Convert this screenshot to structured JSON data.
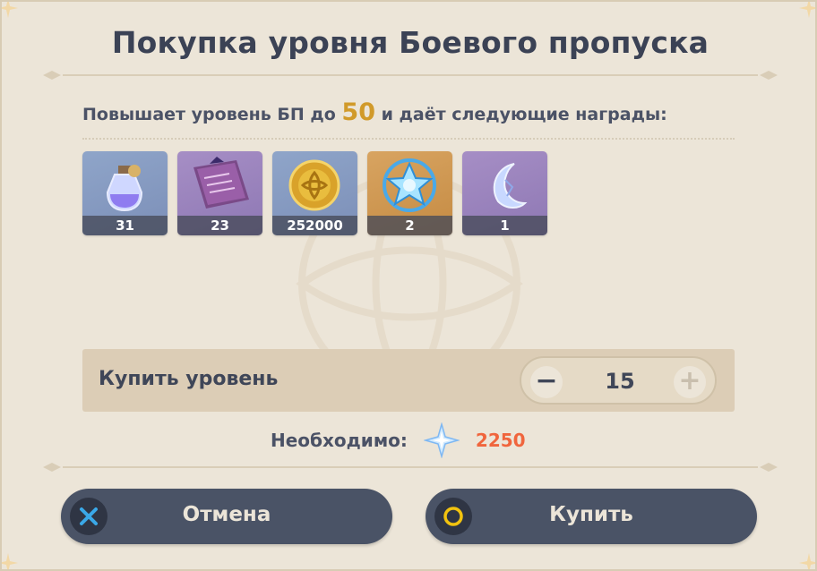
{
  "dialog": {
    "title": "Покупка уровня Боевого пропуска",
    "subtitle_pre": "Повышает уровень БП до",
    "target_level": "50",
    "subtitle_post": "и даёт следующие награды:"
  },
  "rewards": [
    {
      "name": "potion-icon",
      "count": "31"
    },
    {
      "name": "book-icon",
      "count": "23"
    },
    {
      "name": "mora-coin-icon",
      "count": "252000"
    },
    {
      "name": "crystal-icon",
      "count": "2"
    },
    {
      "name": "moon-crystal-icon",
      "count": "1"
    }
  ],
  "purchase": {
    "label": "Купить уровень",
    "quantity": "15",
    "minus": "−",
    "plus": "+"
  },
  "cost": {
    "label": "Необходимо:",
    "currency_icon": "primogem-icon",
    "amount": "2250"
  },
  "buttons": {
    "cancel": "Отмена",
    "confirm": "Купить"
  },
  "colors": {
    "background": "#ece5d8",
    "button": "#4a5366",
    "accent_level": "#d19a2a",
    "cost": "#f0653d",
    "cancel_glyph": "#3aa8e8",
    "confirm_glyph": "#f2c30f"
  }
}
